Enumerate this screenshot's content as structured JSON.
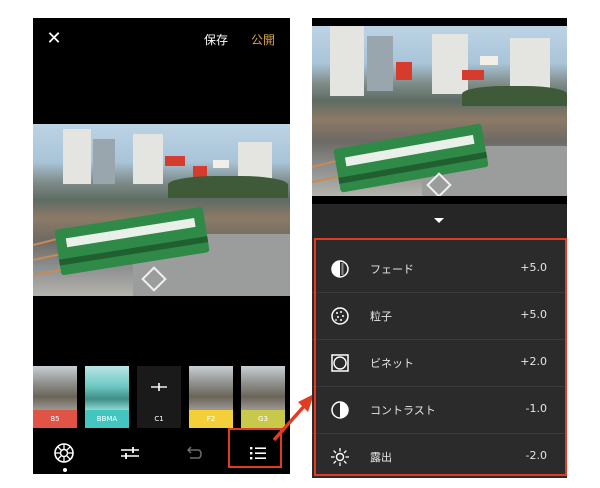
{
  "left_screen": {
    "header": {
      "close_icon": "close-icon",
      "save_label": "保存",
      "publish_label": "公開",
      "publish_color": "#d7a44a"
    },
    "filters": [
      {
        "label": "B5",
        "color": "#e05446",
        "selected": false
      },
      {
        "label": "BBMA",
        "color": "#43c6c0",
        "selected": false
      },
      {
        "label": "C1",
        "color": "#1a1a1a",
        "selected": true
      },
      {
        "label": "F2",
        "color": "#f3d03a",
        "selected": false
      },
      {
        "label": "G3",
        "color": "#c8c84a",
        "selected": false
      }
    ],
    "toolbar": {
      "items": [
        {
          "icon": "presets-icon",
          "active": true
        },
        {
          "icon": "adjust-sliders-icon",
          "active": false
        },
        {
          "icon": "undo-icon",
          "active": false
        },
        {
          "icon": "list-icon",
          "active": false
        }
      ]
    }
  },
  "right_screen": {
    "collapse_icon": "chevron-down-icon",
    "adjustments": [
      {
        "name": "フェード",
        "value": "+5.0",
        "icon": "fade-icon"
      },
      {
        "name": "粒子",
        "value": "+5.0",
        "icon": "grain-icon"
      },
      {
        "name": "ビネット",
        "value": "+2.0",
        "icon": "vignette-icon"
      },
      {
        "name": "コントラスト",
        "value": "-1.0",
        "icon": "contrast-icon"
      },
      {
        "name": "露出",
        "value": "-2.0",
        "icon": "exposure-icon"
      }
    ]
  },
  "accent": {
    "highlight": "#e23b22"
  }
}
